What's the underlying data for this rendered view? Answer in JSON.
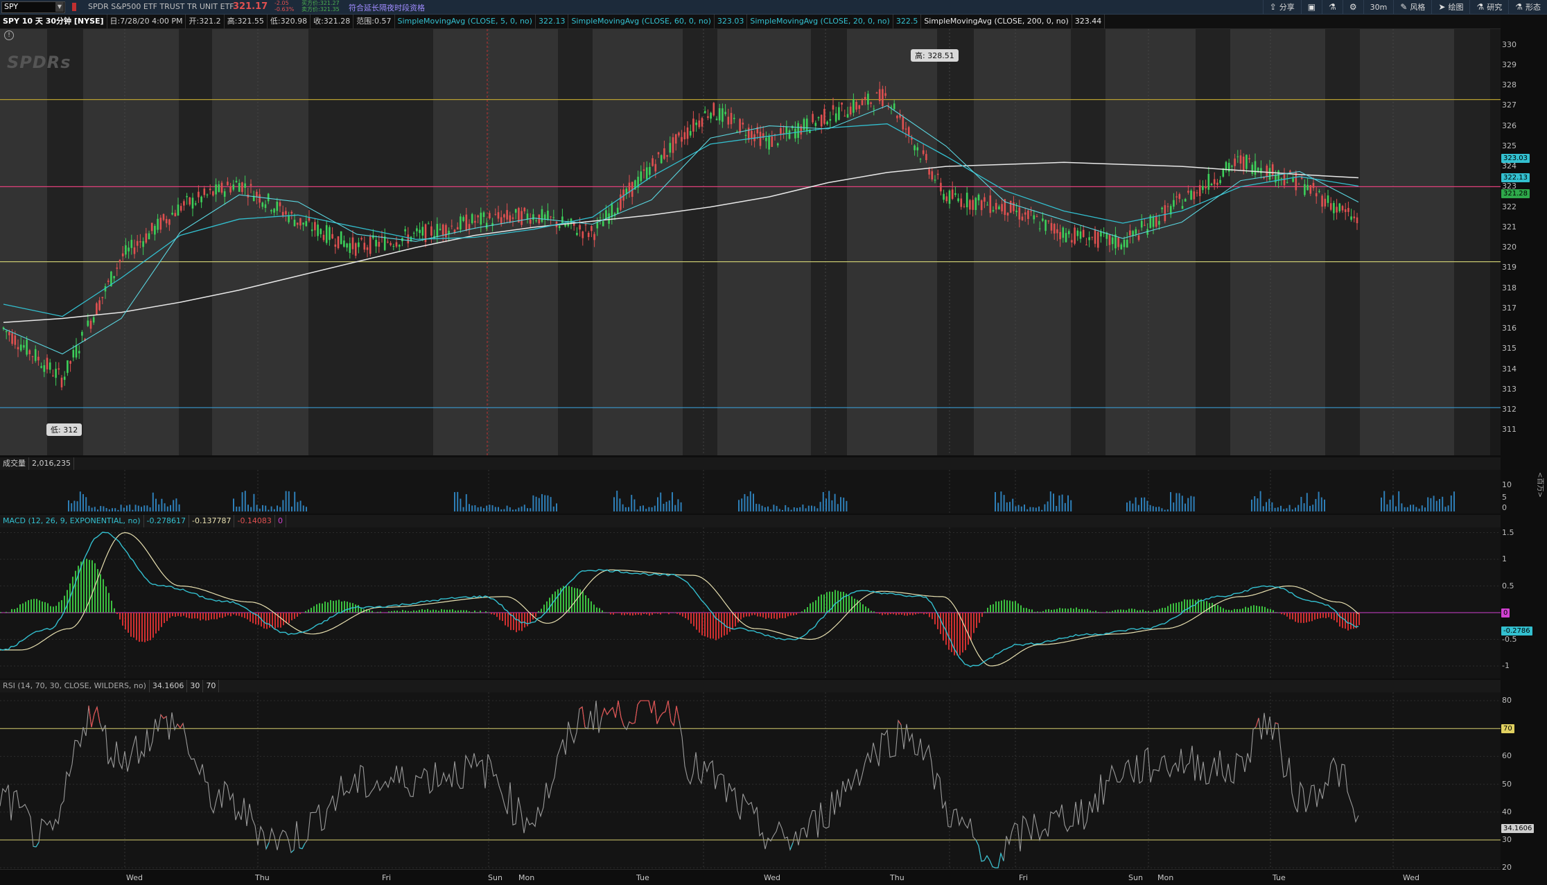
{
  "toolbar": {
    "symbol": "SPY",
    "name": "SPDR S&P500 ETF TRUST TR UNIT ETF",
    "last": "321.17",
    "change": "-2.05",
    "change_pct": "-0.63%",
    "bid": "买方价:321.27",
    "ask": "卖方价:321.35",
    "extended_text": "符合延长隔夜时段资格",
    "colors": {
      "bg": "#1c2a3a",
      "up": "#4caf50",
      "down": "#e05050",
      "link": "#9f8cff"
    },
    "buttons": [
      {
        "icon": "share-icon",
        "label": "分享"
      },
      {
        "icon": "layout-icon",
        "label": ""
      },
      {
        "icon": "flask-icon",
        "label": ""
      },
      {
        "icon": "gear-icon",
        "label": ""
      },
      {
        "icon": "",
        "label": "30m"
      },
      {
        "icon": "style-icon",
        "label": "风格"
      },
      {
        "icon": "cursor-icon",
        "label": "绘图"
      },
      {
        "icon": "flask-icon",
        "label": "研究"
      },
      {
        "icon": "pattern-icon",
        "label": "形态"
      }
    ]
  },
  "study_bar": {
    "period": "SPY 10 天 30分钟 [NYSE]",
    "date": "日:7/28/20 4:00 PM",
    "open": "开:321.2",
    "high": "高:321.55",
    "low": "低:320.98",
    "close": "收:321.28",
    "range": "范围:0.57",
    "sma5": "SimpleMovingAvg (CLOSE, 5, 0, no)",
    "sma5_val": "322.13",
    "sma60": "SimpleMovingAvg (CLOSE, 60, 0, no)",
    "sma60_val": "323.03",
    "sma20": "SimpleMovingAvg (CLOSE, 20, 0, no)",
    "sma20_val": "322.5",
    "sma200": "SimpleMovingAvg (CLOSE, 200, 0, no)",
    "sma200_val": "323.44"
  },
  "price_pane": {
    "y_ticks": [
      "330",
      "329",
      "328",
      "327",
      "326",
      "325",
      "324",
      "323",
      "322",
      "321",
      "320",
      "319",
      "318",
      "317",
      "316",
      "315",
      "314",
      "313",
      "312",
      "311"
    ],
    "high_label": "高: 328.51",
    "low_label": "低: 312",
    "tags": [
      {
        "text": "323.03",
        "color": "#33c0d0"
      },
      {
        "text": "322.13",
        "color": "#33c0d0"
      },
      {
        "text": "321.28",
        "color": "#2ea84a"
      }
    ],
    "hlines": [
      {
        "value": 327.3,
        "color": "#b8a030"
      },
      {
        "value": 323.0,
        "color": "#e0407a"
      },
      {
        "value": 319.3,
        "color": "#c8c870"
      },
      {
        "value": 312.1,
        "color": "#3a9ad0"
      }
    ]
  },
  "volume_pane": {
    "label": "成交量",
    "value": "2,016,235",
    "y_ticks": [
      "10",
      "5",
      "0"
    ],
    "unit": "<百万>"
  },
  "macd_pane": {
    "label": "MACD (12, 26, 9, EXPONENTIAL, no)",
    "value": "-0.278617",
    "avg": "-0.137787",
    "diff": "-0.14083",
    "zero": "0",
    "y_ticks": [
      "1.5",
      "1",
      "0.5",
      "0",
      "-0.5",
      "-1"
    ],
    "tags": [
      {
        "text": "0",
        "color": "#d040d0"
      },
      {
        "text": "-0.2786",
        "color": "#33c0d0"
      }
    ]
  },
  "rsi_pane": {
    "label": "RSI (14, 70, 30, CLOSE, WILDERS, no)",
    "value": "34.1606",
    "oversold": "30",
    "overbought": "70",
    "y_ticks": [
      "80",
      "70",
      "60",
      "50",
      "40",
      "30",
      "20"
    ],
    "tags": [
      {
        "text": "70",
        "color": "#e0d060"
      },
      {
        "text": "34.1606",
        "color": "#cfcfcf"
      }
    ]
  },
  "x_axis": {
    "labels": [
      {
        "text": "Wed"
      },
      {
        "text": "Thu"
      },
      {
        "text": "Fri"
      },
      {
        "text": "Sun"
      },
      {
        "text": "Mon"
      },
      {
        "text": "Tue"
      },
      {
        "text": "Wed"
      },
      {
        "text": "Thu"
      },
      {
        "text": "Fri"
      },
      {
        "text": "Sun"
      },
      {
        "text": "Mon"
      },
      {
        "text": "Tue"
      },
      {
        "text": "Wed"
      }
    ]
  },
  "chart_data": {
    "type": "line",
    "title": "SPY 10 天 30分钟 [NYSE]",
    "ylim": [
      310.5,
      330.5
    ],
    "series": [
      {
        "name": "SimpleMovingAvg (CLOSE, 200, 0, no)",
        "values": [
          316.3,
          316.5,
          316.8,
          317.3,
          317.9,
          318.6,
          319.3,
          320.0,
          320.6,
          321.0,
          321.3,
          321.6,
          322.0,
          322.5,
          323.2,
          323.7,
          324.0,
          324.1,
          324.2,
          324.1,
          324.0,
          323.8,
          323.6,
          323.44
        ]
      },
      {
        "name": "SimpleMovingAvg (CLOSE, 60, 0, no)",
        "values": [
          317.2,
          316.6,
          318.5,
          320.6,
          321.4,
          321.6,
          321.0,
          320.4,
          320.5,
          320.9,
          321.5,
          323.5,
          325.1,
          325.5,
          325.9,
          326.1,
          324.5,
          322.8,
          321.8,
          321.2,
          321.8,
          323.0,
          323.5,
          323.03
        ]
      },
      {
        "name": "Close",
        "values": [
          316.0,
          313.5,
          319.5,
          322.0,
          323.2,
          321.3,
          320.0,
          320.6,
          321.3,
          321.6,
          320.7,
          324.0,
          326.8,
          325.2,
          326.5,
          327.5,
          322.5,
          322.0,
          320.7,
          320.2,
          322.3,
          324.3,
          323.2,
          321.28
        ]
      }
    ]
  }
}
